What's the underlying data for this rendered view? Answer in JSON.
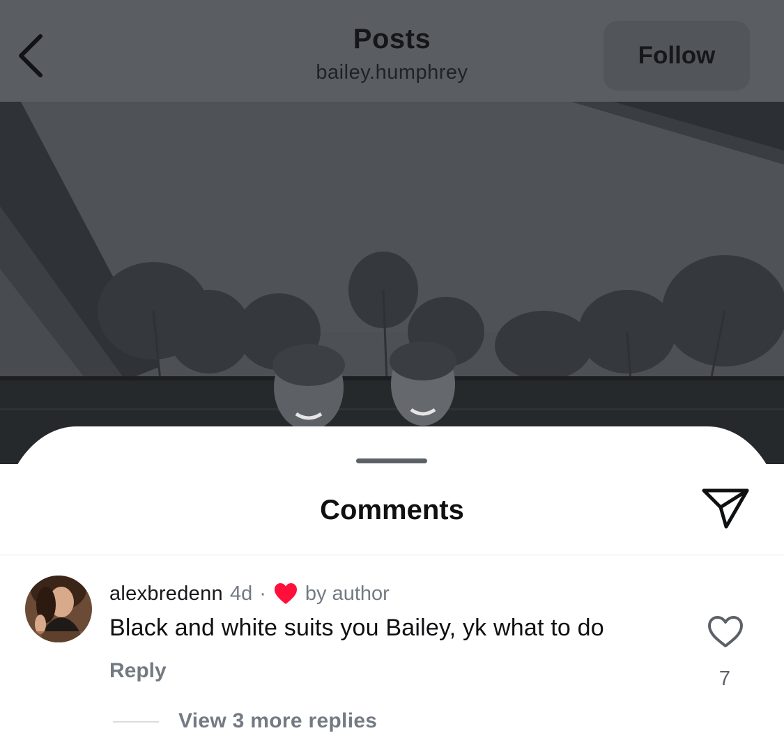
{
  "header": {
    "title": "Posts",
    "username": "bailey.humphrey",
    "follow_label": "Follow",
    "back_icon": "chevron-left-icon"
  },
  "post": {
    "image_description": "black-and-white-photo"
  },
  "comments_sheet": {
    "title": "Comments",
    "share_icon": "paper-plane-icon",
    "comments": [
      {
        "username": "alexbredenn",
        "time": "4d",
        "separator": "·",
        "liked_by_author_label": "by author",
        "text": "Black and white suits you Bailey, yk what to do",
        "reply_label": "Reply",
        "like_count": "7",
        "view_replies_label": "View 3 more replies"
      }
    ]
  },
  "colors": {
    "dim_overlay": "#5a5e63",
    "heart_red": "#ff0f3a",
    "secondary_text": "#737a82",
    "primary_text": "#0f1012"
  }
}
